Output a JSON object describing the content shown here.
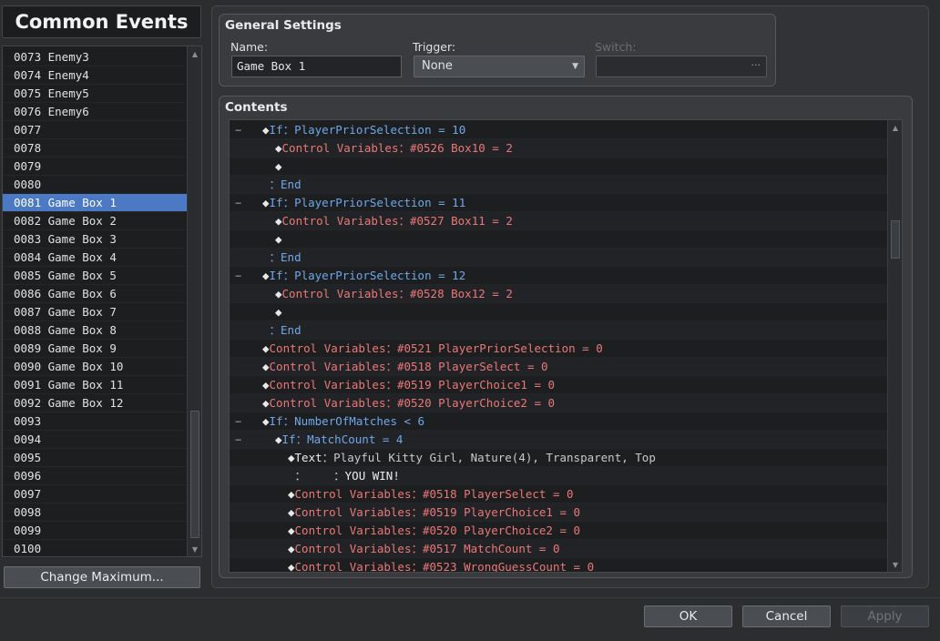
{
  "window": {
    "title": "Common Events"
  },
  "events": {
    "items": [
      {
        "label": "0073 Enemy3"
      },
      {
        "label": "0074 Enemy4"
      },
      {
        "label": "0075 Enemy5"
      },
      {
        "label": "0076 Enemy6"
      },
      {
        "label": "0077"
      },
      {
        "label": "0078"
      },
      {
        "label": "0079"
      },
      {
        "label": "0080"
      },
      {
        "label": "0081 Game Box 1"
      },
      {
        "label": "0082 Game Box 2"
      },
      {
        "label": "0083 Game Box 3"
      },
      {
        "label": "0084 Game Box 4"
      },
      {
        "label": "0085 Game Box 5"
      },
      {
        "label": "0086 Game Box 6"
      },
      {
        "label": "0087 Game Box 7"
      },
      {
        "label": "0088 Game Box 8"
      },
      {
        "label": "0089 Game Box 9"
      },
      {
        "label": "0090 Game Box 10"
      },
      {
        "label": "0091 Game Box 11"
      },
      {
        "label": "0092 Game Box 12"
      },
      {
        "label": "0093"
      },
      {
        "label": "0094"
      },
      {
        "label": "0095"
      },
      {
        "label": "0096"
      },
      {
        "label": "0097"
      },
      {
        "label": "0098"
      },
      {
        "label": "0099"
      },
      {
        "label": "0100"
      }
    ],
    "selected_index": 8,
    "change_max_label": "Change Maximum..."
  },
  "general": {
    "title": "General Settings",
    "name_label": "Name:",
    "name_value": "Game Box 1",
    "trigger_label": "Trigger:",
    "trigger_value": "None",
    "switch_label": "Switch:",
    "switch_button": "···"
  },
  "contents": {
    "title": "Contents",
    "lines": [
      {
        "fold": "−",
        "indent": 1,
        "parts": [
          {
            "t": "◆",
            "c": "diamond"
          },
          {
            "t": "If：PlayerPriorSelection = 10",
            "c": "blue"
          }
        ]
      },
      {
        "fold": "",
        "indent": 2,
        "parts": [
          {
            "t": "◆",
            "c": "diamond"
          },
          {
            "t": "Control Variables：#0526 Box10 = 2",
            "c": "red"
          }
        ]
      },
      {
        "fold": "",
        "indent": 2,
        "parts": [
          {
            "t": "◆",
            "c": "diamond"
          }
        ]
      },
      {
        "fold": "",
        "indent": 1,
        "parts": [
          {
            "t": " ：End",
            "c": "blue"
          }
        ]
      },
      {
        "fold": "−",
        "indent": 1,
        "parts": [
          {
            "t": "◆",
            "c": "diamond"
          },
          {
            "t": "If：PlayerPriorSelection = 11",
            "c": "blue"
          }
        ]
      },
      {
        "fold": "",
        "indent": 2,
        "parts": [
          {
            "t": "◆",
            "c": "diamond"
          },
          {
            "t": "Control Variables：#0527 Box11 = 2",
            "c": "red"
          }
        ]
      },
      {
        "fold": "",
        "indent": 2,
        "parts": [
          {
            "t": "◆",
            "c": "diamond"
          }
        ]
      },
      {
        "fold": "",
        "indent": 1,
        "parts": [
          {
            "t": " ：End",
            "c": "blue"
          }
        ]
      },
      {
        "fold": "−",
        "indent": 1,
        "parts": [
          {
            "t": "◆",
            "c": "diamond"
          },
          {
            "t": "If：PlayerPriorSelection = 12",
            "c": "blue"
          }
        ]
      },
      {
        "fold": "",
        "indent": 2,
        "parts": [
          {
            "t": "◆",
            "c": "diamond"
          },
          {
            "t": "Control Variables：#0528 Box12 = 2",
            "c": "red"
          }
        ]
      },
      {
        "fold": "",
        "indent": 2,
        "parts": [
          {
            "t": "◆",
            "c": "diamond"
          }
        ]
      },
      {
        "fold": "",
        "indent": 1,
        "parts": [
          {
            "t": " ：End",
            "c": "blue"
          }
        ]
      },
      {
        "fold": "",
        "indent": 1,
        "parts": [
          {
            "t": "◆",
            "c": "diamond"
          },
          {
            "t": "Control Variables：#0521 PlayerPriorSelection = 0",
            "c": "red"
          }
        ]
      },
      {
        "fold": "",
        "indent": 1,
        "parts": [
          {
            "t": "◆",
            "c": "diamond"
          },
          {
            "t": "Control Variables：#0518 PlayerSelect = 0",
            "c": "red"
          }
        ]
      },
      {
        "fold": "",
        "indent": 1,
        "parts": [
          {
            "t": "◆",
            "c": "diamond"
          },
          {
            "t": "Control Variables：#0519 PlayerChoice1 = 0",
            "c": "red"
          }
        ]
      },
      {
        "fold": "",
        "indent": 1,
        "parts": [
          {
            "t": "◆",
            "c": "diamond"
          },
          {
            "t": "Control Variables：#0520 PlayerChoice2 = 0",
            "c": "red"
          }
        ]
      },
      {
        "fold": "−",
        "indent": 1,
        "parts": [
          {
            "t": "◆",
            "c": "diamond"
          },
          {
            "t": "If：NumberOfMatches < 6",
            "c": "blue"
          }
        ]
      },
      {
        "fold": "−",
        "indent": 2,
        "parts": [
          {
            "t": "◆",
            "c": "diamond"
          },
          {
            "t": "If：MatchCount = 4",
            "c": "blue"
          }
        ]
      },
      {
        "fold": "",
        "indent": 3,
        "parts": [
          {
            "t": "◆",
            "c": "diamond"
          },
          {
            "t": "Text",
            "c": "white"
          },
          {
            "t": "：Playful Kitty Girl, Nature(4), Transparent, Top",
            "c": "gray"
          }
        ]
      },
      {
        "fold": "",
        "indent": 3,
        "parts": [
          {
            "t": " ：    ：",
            "c": "gray"
          },
          {
            "t": "YOU WIN!",
            "c": "white"
          }
        ]
      },
      {
        "fold": "",
        "indent": 3,
        "parts": [
          {
            "t": "◆",
            "c": "diamond"
          },
          {
            "t": "Control Variables：#0518 PlayerSelect = 0",
            "c": "red"
          }
        ]
      },
      {
        "fold": "",
        "indent": 3,
        "parts": [
          {
            "t": "◆",
            "c": "diamond"
          },
          {
            "t": "Control Variables：#0519 PlayerChoice1 = 0",
            "c": "red"
          }
        ]
      },
      {
        "fold": "",
        "indent": 3,
        "parts": [
          {
            "t": "◆",
            "c": "diamond"
          },
          {
            "t": "Control Variables：#0520 PlayerChoice2 = 0",
            "c": "red"
          }
        ]
      },
      {
        "fold": "",
        "indent": 3,
        "parts": [
          {
            "t": "◆",
            "c": "diamond"
          },
          {
            "t": "Control Variables：#0517 MatchCount = 0",
            "c": "red"
          }
        ]
      },
      {
        "fold": "",
        "indent": 3,
        "parts": [
          {
            "t": "◆",
            "c": "diamond"
          },
          {
            "t": "Control Variables：#0523 WrongGuessCount = 0",
            "c": "red"
          }
        ]
      }
    ]
  },
  "buttons": {
    "ok": "OK",
    "cancel": "Cancel",
    "apply": "Apply"
  },
  "icons": {
    "scroll_up": "arrow-up-icon",
    "scroll_down": "arrow-down-icon",
    "dropdown": "chevron-down-icon",
    "fold": "collapse-icon",
    "command": "diamond-icon"
  },
  "colors": {
    "selection": "#4c79c4",
    "condition": "#6fa8ea",
    "variable": "#ea7878"
  }
}
